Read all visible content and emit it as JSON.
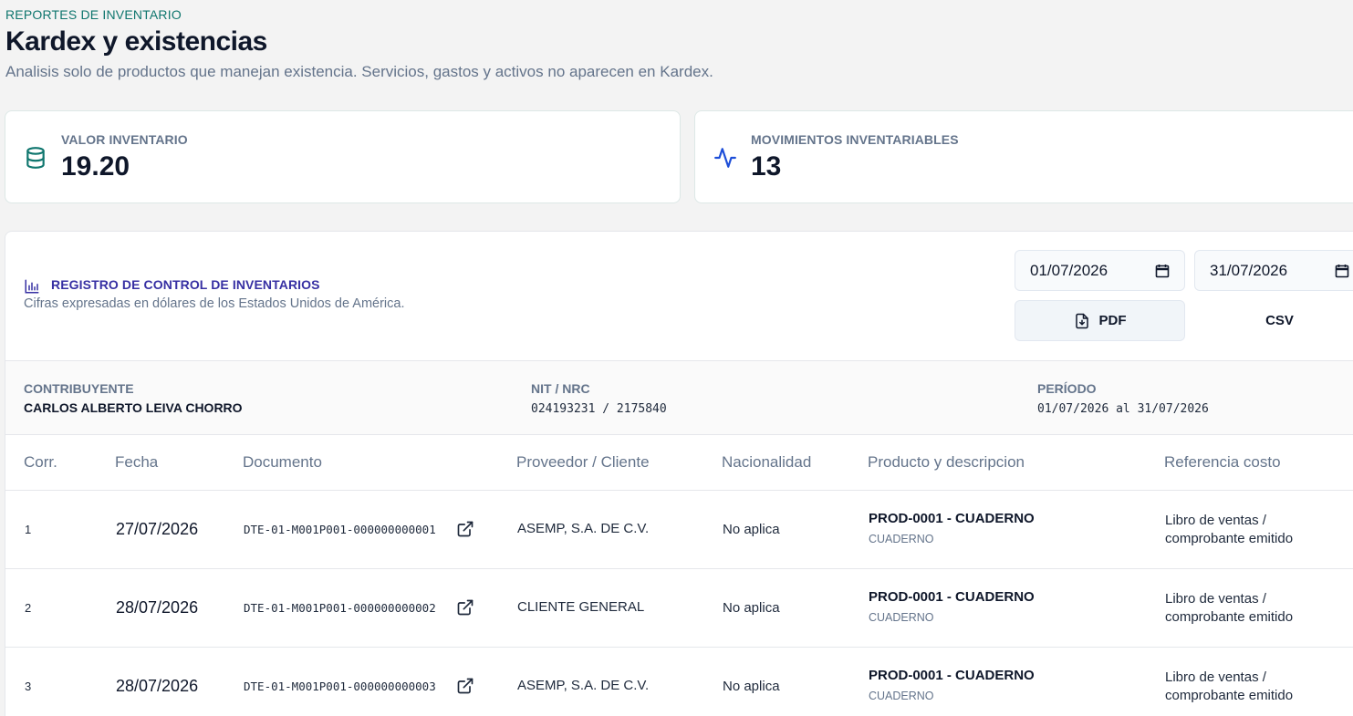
{
  "header": {
    "eyebrow": "REPORTES DE INVENTARIO",
    "title": "Kardex y existencias",
    "subtitle": "Analisis solo de productos que manejan existencia. Servicios, gastos y activos no aparecen en Kardex."
  },
  "kpis": [
    {
      "label": "VALOR INVENTARIO",
      "value": "19.20",
      "icon": "database-icon",
      "color": "#0f766e"
    },
    {
      "label": "MOVIMIENTOS INVENTARIABLES",
      "value": "13",
      "icon": "activity-icon",
      "color": "#1d4ed8"
    }
  ],
  "register": {
    "title": "REGISTRO DE CONTROL DE INVENTARIOS",
    "subtitle": "Cifras expresadas en dólares de los Estados Unidos de América.",
    "date_from": "01/07/2026",
    "date_to": "31/07/2026",
    "pdf_label": "PDF",
    "csv_label": "CSV"
  },
  "meta": {
    "contribuyente_label": "CONTRIBUYENTE",
    "contribuyente_value": "CARLOS ALBERTO LEIVA CHORRO",
    "nit_label": "NIT / NRC",
    "nit_value": "024193231 / 2175840",
    "periodo_label": "PERÍODO",
    "periodo_value": "01/07/2026 al 31/07/2026"
  },
  "table": {
    "columns": [
      "Corr.",
      "Fecha",
      "Documento",
      "Proveedor / Cliente",
      "Nacionalidad",
      "Producto y descripcion",
      "Referencia costo"
    ],
    "rows": [
      {
        "corr": "1",
        "fecha": "27/07/2026",
        "documento": "DTE-01-M001P001-000000000001",
        "proveedor": "ASEMP, S.A. DE C.V.",
        "nacionalidad": "No aplica",
        "producto": "PROD-0001 - CUADERNO",
        "descripcion": "CUADERNO",
        "referencia": "Libro de ventas / comprobante emitido"
      },
      {
        "corr": "2",
        "fecha": "28/07/2026",
        "documento": "DTE-01-M001P001-000000000002",
        "proveedor": "CLIENTE GENERAL",
        "nacionalidad": "No aplica",
        "producto": "PROD-0001 - CUADERNO",
        "descripcion": "CUADERNO",
        "referencia": "Libro de ventas / comprobante emitido"
      },
      {
        "corr": "3",
        "fecha": "28/07/2026",
        "documento": "DTE-01-M001P001-000000000003",
        "proveedor": "ASEMP, S.A. DE C.V.",
        "nacionalidad": "No aplica",
        "producto": "PROD-0001 - CUADERNO",
        "descripcion": "CUADERNO",
        "referencia": "Libro de ventas / comprobante emitido"
      }
    ]
  }
}
